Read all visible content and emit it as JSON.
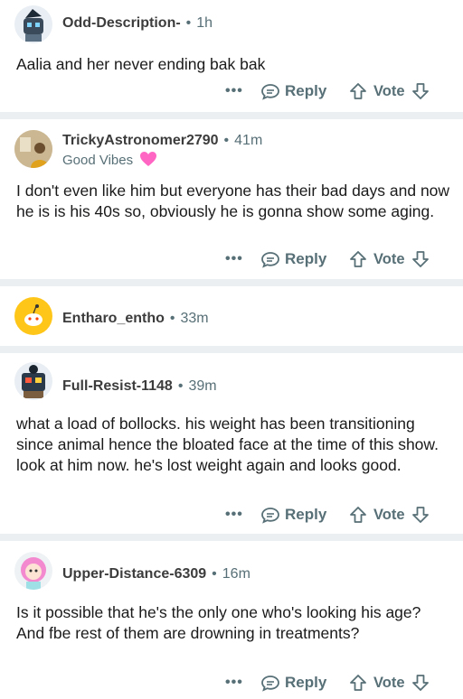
{
  "comments": [
    {
      "username": "Odd-Description-",
      "time": "1h",
      "flair": "",
      "body": "Aalia and her never ending bak bak",
      "reply_label": "Reply",
      "vote_label": "Vote"
    },
    {
      "username": "TrickyAstronomer2790",
      "time": "41m",
      "flair": "Good Vibes",
      "body": "I don't even like him but everyone has their bad days and now he is is his 40s so, obviously he is gonna show some aging.",
      "reply_label": "Reply",
      "vote_label": "Vote"
    },
    {
      "username": "Entharo_entho",
      "time": "33m",
      "flair": "",
      "body": "",
      "reply_label": "",
      "vote_label": ""
    },
    {
      "username": "Full-Resist-1148",
      "time": "39m",
      "flair": "",
      "body": "what a load of bollocks. his weight has been transitioning since animal hence the bloated face at the time of this show. look at him now. he's lost weight again and looks good.",
      "reply_label": "Reply",
      "vote_label": "Vote"
    },
    {
      "username": "Upper-Distance-6309",
      "time": "16m",
      "flair": "",
      "body": "Is it possible that he's the only one who's looking his age? And fbe rest of them are drowning in treatments?",
      "reply_label": "Reply",
      "vote_label": "Vote"
    }
  ],
  "separator_dot": "•",
  "more_glyph": "•••",
  "colors": {
    "meta_gray": "#576f76",
    "separator": "#eceff1",
    "flair_heart": "#ff66c4"
  }
}
